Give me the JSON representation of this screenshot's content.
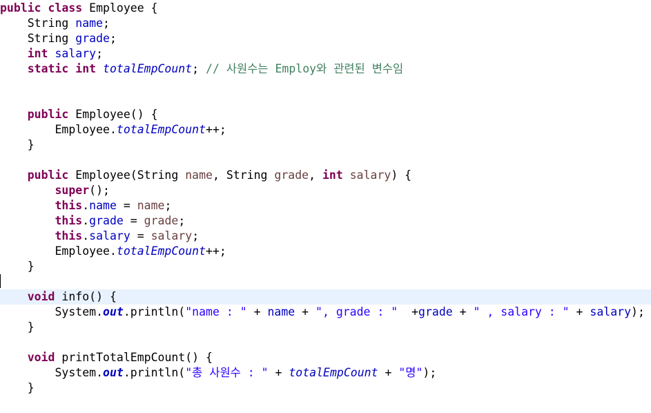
{
  "editor": {
    "language": "java",
    "current_line": 19,
    "colors": {
      "keyword": "#7f0055",
      "field": "#0000c0",
      "string": "#2a00ff",
      "comment": "#3f7f5f",
      "parameter": "#6a3e3e",
      "current_line_highlight": "#e8f2fe"
    },
    "lines": [
      [
        {
          "t": "public class",
          "c": "kw"
        },
        {
          "t": " Employee {",
          "c": "plain"
        }
      ],
      [
        {
          "t": "    String ",
          "c": "plain"
        },
        {
          "t": "name",
          "c": "fld"
        },
        {
          "t": ";",
          "c": "plain"
        }
      ],
      [
        {
          "t": "    String ",
          "c": "plain"
        },
        {
          "t": "grade",
          "c": "fld"
        },
        {
          "t": ";",
          "c": "plain"
        }
      ],
      [
        {
          "t": "    ",
          "c": "plain"
        },
        {
          "t": "int",
          "c": "kw"
        },
        {
          "t": " ",
          "c": "plain"
        },
        {
          "t": "salary",
          "c": "fld"
        },
        {
          "t": ";",
          "c": "plain"
        }
      ],
      [
        {
          "t": "    ",
          "c": "plain"
        },
        {
          "t": "static int",
          "c": "kw"
        },
        {
          "t": " ",
          "c": "plain"
        },
        {
          "t": "totalEmpCount",
          "c": "sfld"
        },
        {
          "t": "; ",
          "c": "plain"
        },
        {
          "t": "// 사원수는 Employ와 관련된 변수임",
          "c": "cmt"
        }
      ],
      [],
      [],
      [
        {
          "t": "    ",
          "c": "plain"
        },
        {
          "t": "public",
          "c": "kw"
        },
        {
          "t": " Employee() {",
          "c": "plain"
        }
      ],
      [
        {
          "t": "        Employee.",
          "c": "plain"
        },
        {
          "t": "totalEmpCount",
          "c": "sfld"
        },
        {
          "t": "++;",
          "c": "plain"
        }
      ],
      [
        {
          "t": "    }",
          "c": "plain"
        }
      ],
      [],
      [
        {
          "t": "    ",
          "c": "plain"
        },
        {
          "t": "public",
          "c": "kw"
        },
        {
          "t": " Employee(String ",
          "c": "plain"
        },
        {
          "t": "name",
          "c": "prm"
        },
        {
          "t": ", String ",
          "c": "plain"
        },
        {
          "t": "grade",
          "c": "prm"
        },
        {
          "t": ", ",
          "c": "plain"
        },
        {
          "t": "int",
          "c": "kw"
        },
        {
          "t": " ",
          "c": "plain"
        },
        {
          "t": "salary",
          "c": "prm"
        },
        {
          "t": ") {",
          "c": "plain"
        }
      ],
      [
        {
          "t": "        ",
          "c": "plain"
        },
        {
          "t": "super",
          "c": "kw"
        },
        {
          "t": "();",
          "c": "plain"
        }
      ],
      [
        {
          "t": "        ",
          "c": "plain"
        },
        {
          "t": "this",
          "c": "kw"
        },
        {
          "t": ".",
          "c": "plain"
        },
        {
          "t": "name",
          "c": "fld"
        },
        {
          "t": " = ",
          "c": "plain"
        },
        {
          "t": "name",
          "c": "prm"
        },
        {
          "t": ";",
          "c": "plain"
        }
      ],
      [
        {
          "t": "        ",
          "c": "plain"
        },
        {
          "t": "this",
          "c": "kw"
        },
        {
          "t": ".",
          "c": "plain"
        },
        {
          "t": "grade",
          "c": "fld"
        },
        {
          "t": " = ",
          "c": "plain"
        },
        {
          "t": "grade",
          "c": "prm"
        },
        {
          "t": ";",
          "c": "plain"
        }
      ],
      [
        {
          "t": "        ",
          "c": "plain"
        },
        {
          "t": "this",
          "c": "kw"
        },
        {
          "t": ".",
          "c": "plain"
        },
        {
          "t": "salary",
          "c": "fld"
        },
        {
          "t": " = ",
          "c": "plain"
        },
        {
          "t": "salary",
          "c": "prm"
        },
        {
          "t": ";",
          "c": "plain"
        }
      ],
      [
        {
          "t": "        Employee.",
          "c": "plain"
        },
        {
          "t": "totalEmpCount",
          "c": "sfld"
        },
        {
          "t": "++;",
          "c": "plain"
        }
      ],
      [
        {
          "t": "    }",
          "c": "plain"
        }
      ],
      [],
      [
        {
          "t": "    ",
          "c": "plain"
        },
        {
          "t": "void",
          "c": "kw"
        },
        {
          "t": " info() {",
          "c": "plain"
        }
      ],
      [
        {
          "t": "        System.",
          "c": "plain"
        },
        {
          "t": "out",
          "c": "sfldb"
        },
        {
          "t": ".println(",
          "c": "plain"
        },
        {
          "t": "\"name : \"",
          "c": "str"
        },
        {
          "t": " + ",
          "c": "plain"
        },
        {
          "t": "name",
          "c": "fld"
        },
        {
          "t": " + ",
          "c": "plain"
        },
        {
          "t": "\", grade : \"",
          "c": "str"
        },
        {
          "t": "  +",
          "c": "plain"
        },
        {
          "t": "grade",
          "c": "fld"
        },
        {
          "t": " + ",
          "c": "plain"
        },
        {
          "t": "\" , salary : \"",
          "c": "str"
        },
        {
          "t": " + ",
          "c": "plain"
        },
        {
          "t": "salary",
          "c": "fld"
        },
        {
          "t": ");",
          "c": "plain"
        }
      ],
      [
        {
          "t": "    }",
          "c": "plain"
        }
      ],
      [],
      [
        {
          "t": "    ",
          "c": "plain"
        },
        {
          "t": "void",
          "c": "kw"
        },
        {
          "t": " printTotalEmpCount() {",
          "c": "plain"
        }
      ],
      [
        {
          "t": "        System.",
          "c": "plain"
        },
        {
          "t": "out",
          "c": "sfldb"
        },
        {
          "t": ".println(",
          "c": "plain"
        },
        {
          "t": "\"총 사원수 : \"",
          "c": "str"
        },
        {
          "t": " + ",
          "c": "plain"
        },
        {
          "t": "totalEmpCount",
          "c": "sfld"
        },
        {
          "t": " + ",
          "c": "plain"
        },
        {
          "t": "\"명\"",
          "c": "str"
        },
        {
          "t": ");",
          "c": "plain"
        }
      ],
      [
        {
          "t": "    }",
          "c": "plain"
        }
      ]
    ]
  }
}
